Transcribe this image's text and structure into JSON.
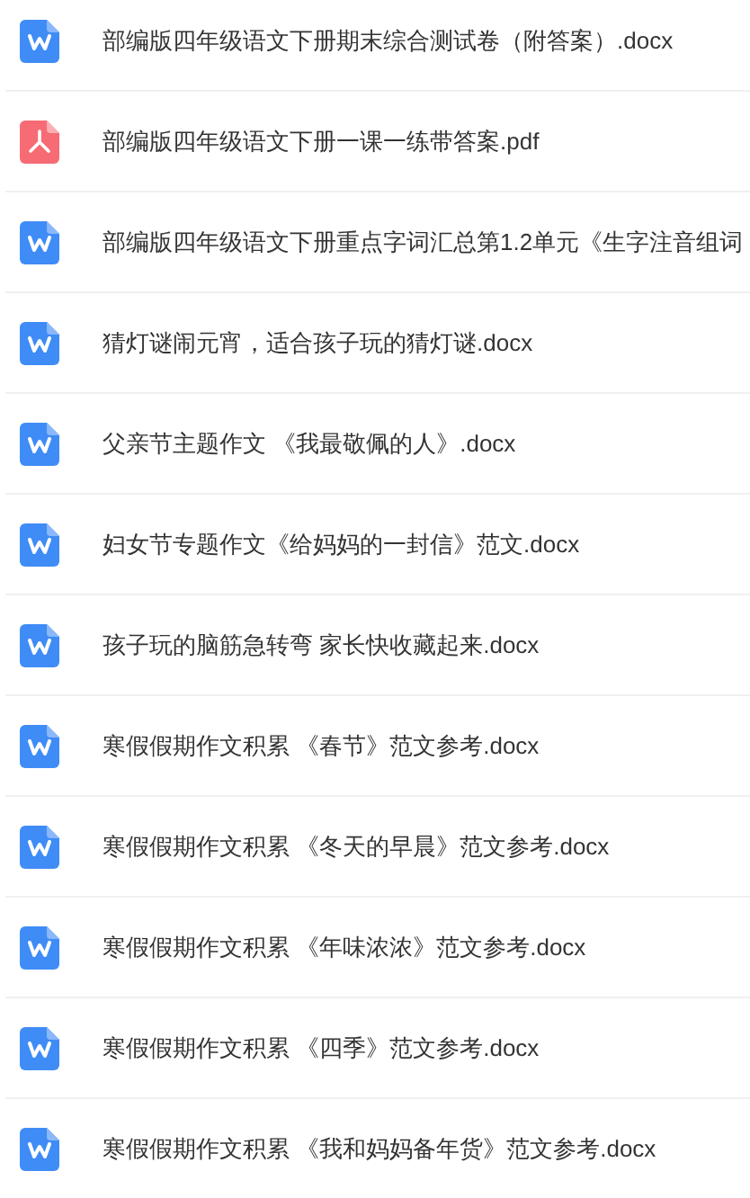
{
  "files": [
    {
      "kind": "word",
      "name": "部编版四年级语文下册期末综合测试卷（附答案）.docx"
    },
    {
      "kind": "pdf",
      "name": "部编版四年级语文下册一课一练带答案.pdf"
    },
    {
      "kind": "word",
      "name": "部编版四年级语文下册重点字词汇总第1.2单元《生字注音组词"
    },
    {
      "kind": "word",
      "name": "猜灯谜闹元宵，适合孩子玩的猜灯谜.docx"
    },
    {
      "kind": "word",
      "name": "父亲节主题作文 《我最敬佩的人》.docx"
    },
    {
      "kind": "word",
      "name": "妇女节专题作文《给妈妈的一封信》范文.docx"
    },
    {
      "kind": "word",
      "name": "孩子玩的脑筋急转弯 家长快收藏起来.docx"
    },
    {
      "kind": "word",
      "name": "寒假假期作文积累 《春节》范文参考.docx"
    },
    {
      "kind": "word",
      "name": "寒假假期作文积累 《冬天的早晨》范文参考.docx"
    },
    {
      "kind": "word",
      "name": "寒假假期作文积累 《年味浓浓》范文参考.docx"
    },
    {
      "kind": "word",
      "name": "寒假假期作文积累 《四季》范文参考.docx"
    },
    {
      "kind": "word",
      "name": "寒假假期作文积累 《我和妈妈备年货》范文参考.docx"
    }
  ]
}
